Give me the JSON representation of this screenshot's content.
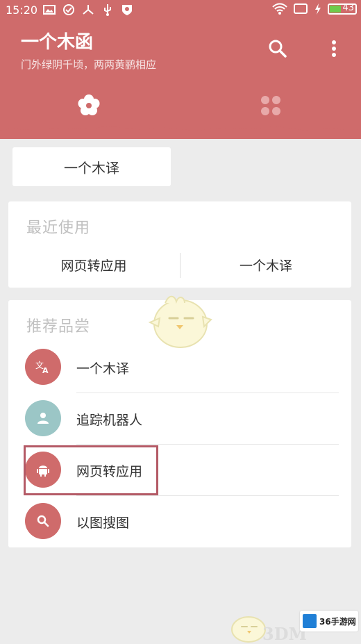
{
  "status_bar": {
    "time": "15:20",
    "battery_level": "43",
    "battery_color": "#6ecb4b",
    "left_icons": [
      "image-icon",
      "check-circle-icon",
      "share-icon",
      "usb-icon",
      "shield-icon"
    ],
    "right_icons": [
      "wifi-icon",
      "screen-icon",
      "charging-icon",
      "battery-icon"
    ]
  },
  "header": {
    "title": "一个木函",
    "subtitle": "门外绿阴千顷，两两黄鹂相应",
    "accent_color": "#cf6b6b",
    "actions": [
      "search-icon",
      "more-vert-icon"
    ],
    "tabs": [
      "flower-icon",
      "grid-icon"
    ]
  },
  "quick_app": {
    "label": "一个木译"
  },
  "recent": {
    "title": "最近使用",
    "items": [
      {
        "label": "网页转应用"
      },
      {
        "label": "一个木译"
      }
    ]
  },
  "recommend": {
    "title": "推荐品尝",
    "items": [
      {
        "label": "一个木译",
        "icon": "translate-icon",
        "color": "#cf6b6b"
      },
      {
        "label": "追踪机器人",
        "icon": "person-icon",
        "color": "#9bc6c6"
      },
      {
        "label": "网页转应用",
        "icon": "android-icon",
        "color": "#cf6b6b"
      },
      {
        "label": "以图搜图",
        "icon": "search-icon",
        "color": "#cf6b6b"
      }
    ]
  },
  "watermarks": {
    "left_text": "3DM",
    "right_text": "36手游网"
  }
}
